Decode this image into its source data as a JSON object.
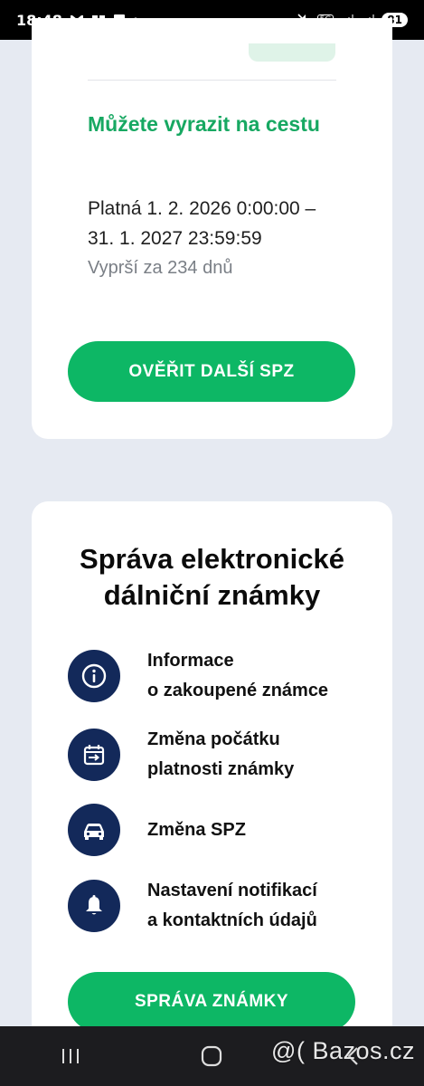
{
  "status_bar": {
    "time": "18:48",
    "battery": "81",
    "network": "5G",
    "icons": [
      "gmail-icon",
      "app-icon",
      "chat-icon",
      "dot-icon",
      "mute-icon",
      "signal-icon",
      "signal-icon",
      "battery-icon"
    ]
  },
  "validity_card": {
    "title": "Můžete vyrazit na cestu",
    "validity_line1": "Platná 1. 2. 2026 0:00:00 –",
    "validity_line2": "31. 1. 2027 23:59:59",
    "expiry": "Vyprší za 234 dnů",
    "verify_button": "OVĚŘIT DALŠÍ SPZ"
  },
  "manage_card": {
    "title_line1": "Správa elektronické",
    "title_line2": "dálniční známky",
    "items": [
      {
        "line1": "Informace",
        "line2": "o zakoupené známce",
        "icon": "info-icon"
      },
      {
        "line1": "Změna počátku",
        "line2": "platnosti známky",
        "icon": "calendar-change-icon"
      },
      {
        "line1": "Změna SPZ",
        "line2": "",
        "icon": "car-icon"
      },
      {
        "line1": "Nastavení notifikací",
        "line2": "a kontaktních údajů",
        "icon": "bell-icon"
      }
    ],
    "manage_button": "SPRÁVA ZNÁMKY"
  },
  "nav_bar": {
    "buttons": [
      "recent-apps",
      "home",
      "back"
    ]
  },
  "watermark": "@( Bazos.cz",
  "colors": {
    "accent_green": "#0db765",
    "title_green": "#17a862",
    "icon_navy": "#13295a",
    "background": "#e6eaf2"
  }
}
